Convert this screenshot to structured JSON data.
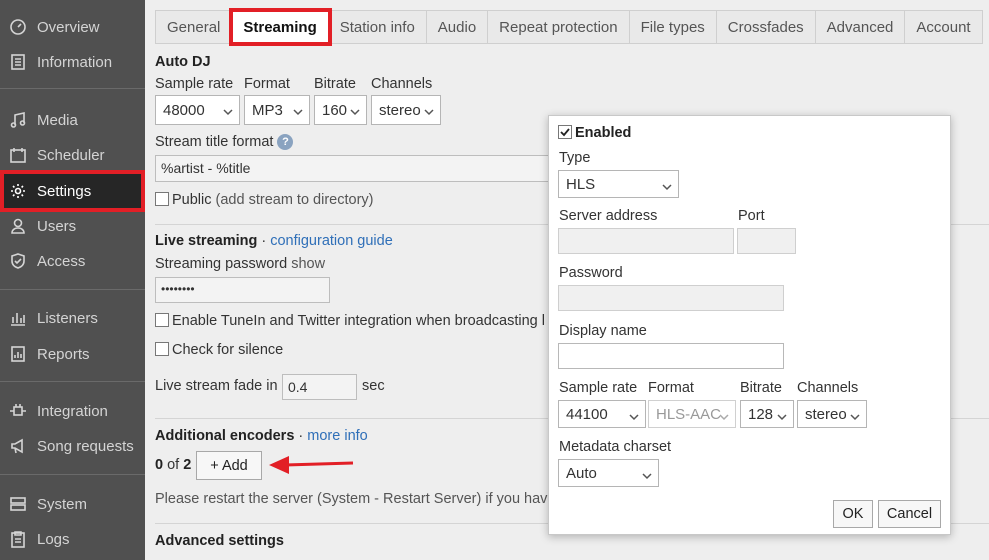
{
  "sidebar": {
    "items": [
      {
        "label": "Overview",
        "icon": "dashboard-icon"
      },
      {
        "label": "Information",
        "icon": "info-list-icon"
      },
      {
        "label": "Media",
        "icon": "music-note-icon"
      },
      {
        "label": "Scheduler",
        "icon": "calendar-icon"
      },
      {
        "label": "Settings",
        "icon": "gear-icon"
      },
      {
        "label": "Users",
        "icon": "user-icon"
      },
      {
        "label": "Access",
        "icon": "shield-icon"
      },
      {
        "label": "Listeners",
        "icon": "bar-chart-icon"
      },
      {
        "label": "Reports",
        "icon": "report-icon"
      },
      {
        "label": "Integration",
        "icon": "plug-icon"
      },
      {
        "label": "Song requests",
        "icon": "megaphone-icon"
      },
      {
        "label": "System",
        "icon": "server-icon"
      },
      {
        "label": "Logs",
        "icon": "clipboard-icon"
      }
    ]
  },
  "tabs": [
    "General",
    "Streaming",
    "Station info",
    "Audio",
    "Repeat protection",
    "File types",
    "Crossfades",
    "Advanced",
    "Account"
  ],
  "autodj": {
    "heading": "Auto DJ",
    "sample_rate_label": "Sample rate",
    "format_label": "Format",
    "bitrate_label": "Bitrate",
    "channels_label": "Channels",
    "sample_rate": "48000",
    "format": "MP3",
    "bitrate": "160",
    "channels": "stereo",
    "title_format_label": "Stream title format",
    "title_format_value": "%artist - %title",
    "public_label": "Public",
    "public_note": "(add stream to directory)"
  },
  "live": {
    "heading": "Live streaming",
    "separator": " · ",
    "guide_link": "configuration guide",
    "password_label": "Streaming password",
    "show_link": "show",
    "password_value": "••••••••",
    "tunein_label": "Enable TuneIn and Twitter integration when broadcasting l",
    "silence_label": "Check for silence",
    "fade_label": "Live stream fade in",
    "fade_value": "0.4",
    "fade_unit": "sec"
  },
  "encoders": {
    "heading": "Additional encoders",
    "separator": " · ",
    "more_link": "more info",
    "count": "0",
    "of": "of",
    "max": "2",
    "add_label": "+ Add",
    "restart_note": "Please restart the server (System - Restart Server) if you have"
  },
  "advanced": {
    "heading": "Advanced settings"
  },
  "dialog": {
    "enabled_label": "Enabled",
    "type_label": "Type",
    "type_value": "HLS",
    "server_label": "Server address",
    "port_label": "Port",
    "password_label": "Password",
    "display_label": "Display name",
    "sample_rate_label": "Sample rate",
    "format_label": "Format",
    "bitrate_label": "Bitrate",
    "channels_label": "Channels",
    "sample_rate": "44100",
    "format": "HLS-AAC",
    "bitrate": "128",
    "channels": "stereo",
    "charset_label": "Metadata charset",
    "charset": "Auto",
    "ok_label": "OK",
    "cancel_label": "Cancel"
  },
  "colors": {
    "highlight": "#e21f26",
    "link": "#2f6fb8",
    "sidebar": "#505050"
  }
}
